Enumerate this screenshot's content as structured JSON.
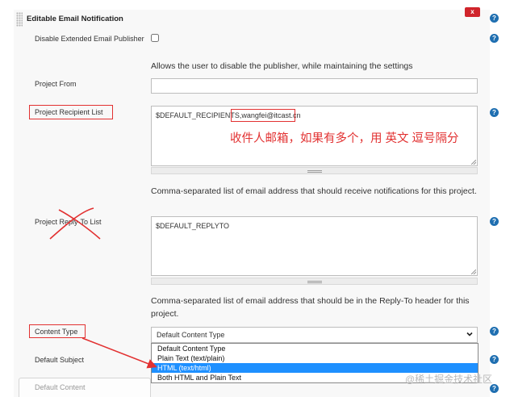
{
  "section": {
    "title": "Editable Email Notification",
    "delete_label": "x",
    "help_glyph": "?"
  },
  "fields": {
    "disable_publisher": {
      "label": "Disable Extended Email Publisher",
      "checked": false,
      "description": "Allows the user to disable the publisher, while maintaining the settings"
    },
    "project_from": {
      "label": "Project From",
      "value": ""
    },
    "recipient_list": {
      "label": "Project Recipient List",
      "value_prefix": "$DEFAULT_RECIPIENTS,",
      "value_email": "wangfei@itcast.cn",
      "description": "Comma-separated list of email address that should receive notifications for this project."
    },
    "reply_to": {
      "label": "Project Reply-To List",
      "value": "$DEFAULT_REPLYTO",
      "description": "Comma-separated list of email address that should be in the Reply-To header for this project."
    },
    "content_type": {
      "label": "Content Type",
      "selected": "Default Content Type",
      "options": [
        "Default Content Type",
        "Plain Text (text/plain)",
        "HTML (text/html)",
        "Both HTML and Plain Text"
      ],
      "highlighted_index": 2
    },
    "default_subject": {
      "label": "Default Subject"
    },
    "default_content": {
      "label": "Default Content"
    }
  },
  "annotation": {
    "note": "收件人邮箱，如果有多个，用 英文 逗号隔分",
    "color": "#e23131"
  },
  "watermark": "@稀土掘金技术社区",
  "colors": {
    "help_icon": "#1f6fb1",
    "delete_button": "#d0242b",
    "option_highlight": "#1e90ff"
  }
}
